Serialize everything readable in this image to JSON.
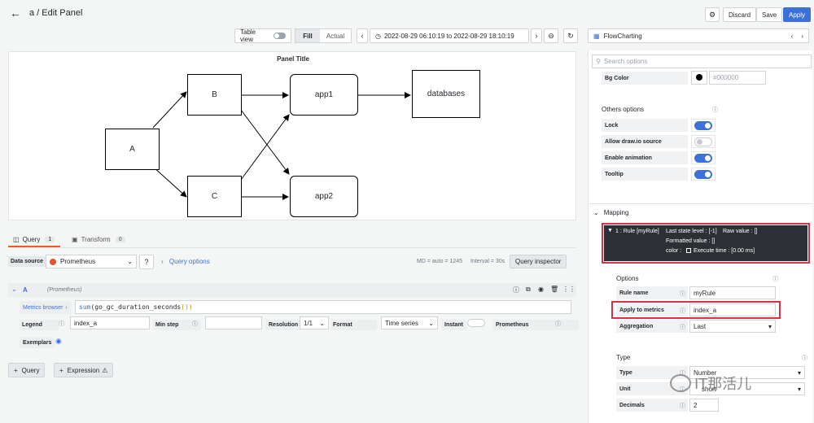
{
  "header": {
    "title": "a / Edit Panel",
    "discard": "Discard",
    "save": "Save",
    "apply": "Apply"
  },
  "toolbar": {
    "table_view": "Table view",
    "fill": "Fill",
    "actual": "Actual",
    "time_range": "2022-08-29 06:10:19 to 2022-08-29 18:10:19",
    "plugin": "FlowCharting"
  },
  "panel": {
    "title": "Panel Title",
    "nodes": {
      "a": "A",
      "b": "B",
      "c": "C",
      "app1": "app1",
      "app2": "app2",
      "databases": "databases"
    }
  },
  "query_tabs": {
    "query": "Query",
    "query_count": "1",
    "transform": "Transform",
    "transform_count": "0"
  },
  "datasource": {
    "label": "Data source",
    "value": "Prometheus",
    "query_options": "Query options",
    "md": "MD = auto = 1245",
    "interval": "Interval = 30s",
    "inspector": "Query inspector"
  },
  "query_a": {
    "name": "A",
    "source": "(Prometheus)",
    "metrics_browser": "Metrics browser",
    "expr_fn": "sum",
    "expr_open": "(",
    "expr_metric": "go_gc_duration_seconds",
    "expr_close": "())",
    "legend_label": "Legend",
    "legend_value": "index_a",
    "min_step": "Min step",
    "resolution_label": "Resolution",
    "resolution_value": "1/1",
    "format_label": "Format",
    "format_value": "Time series",
    "instant_label": "Instant",
    "prometheus_label": "Prometheus",
    "exemplars_label": "Exemplars"
  },
  "bottom_buttons": {
    "query": "Query",
    "expression": "Expression"
  },
  "right": {
    "search_placeholder": "Search options",
    "bg_color_label": "Bg Color",
    "bg_color_value": "#000000",
    "others_title": "Others options",
    "lock": "Lock",
    "allow_drawio": "Allow draw.io source",
    "enable_animation": "Enable animation",
    "tooltip": "Tooltip",
    "mapping_title": "Mapping",
    "rule_line1": "1 : Rule [myRule]",
    "rule_state": "Last state level : [-1]",
    "rule_raw": "Raw value : []",
    "rule_formatted": "Formatted value : []",
    "rule_color": "color :",
    "rule_exec": "Execute time : [0.00 ms]",
    "options_title": "Options",
    "rule_name_label": "Rule name",
    "rule_name_value": "myRule",
    "apply_metrics_label": "Apply to metrics",
    "apply_metrics_value": "index_a",
    "aggregation_label": "Aggregation",
    "aggregation_value": "Last",
    "type_title": "Type",
    "type_label": "Type",
    "type_value": "Number",
    "unit_label": "Unit",
    "unit_value": "short",
    "decimals_label": "Decimals",
    "decimals_value": "2",
    "watermark": "IT那活儿"
  },
  "colors": {
    "accent": "#3d71d9",
    "highlight": "#e02f44",
    "query_tab": "#f05a28"
  }
}
